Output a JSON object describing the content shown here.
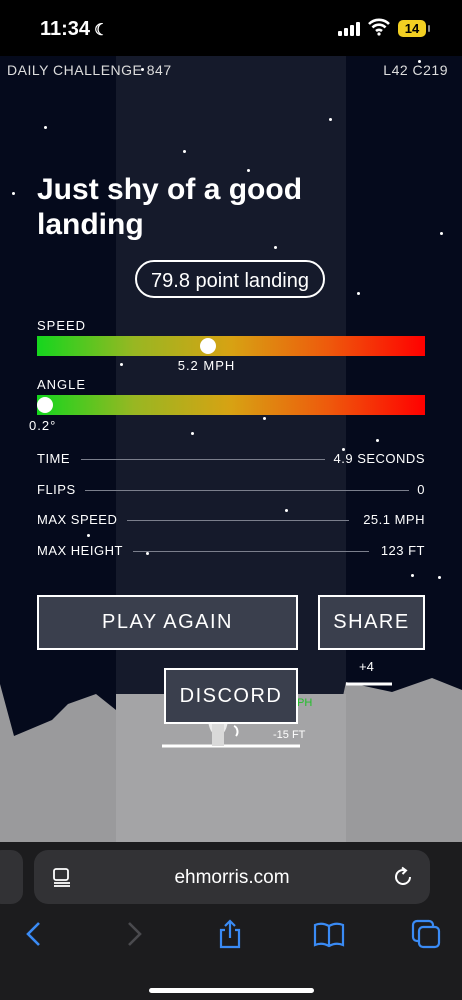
{
  "status": {
    "time": "11:34",
    "battery": "14"
  },
  "hud": {
    "challenge": "DAILY CHALLENGE 847",
    "level": "L42 C219"
  },
  "result": {
    "headline": "Just shy of a good landing",
    "points": "79.8 point landing"
  },
  "meters": {
    "speed": {
      "label": "SPEED",
      "value": "5.2 MPH",
      "level": 0.44
    },
    "angle": {
      "label": "ANGLE",
      "value": "0.2°",
      "level": 0.02
    }
  },
  "stats": [
    {
      "label": "TIME",
      "value": "4.9 SECONDS"
    },
    {
      "label": "FLIPS",
      "value": "0"
    },
    {
      "label": "MAX SPEED",
      "value": "25.1 MPH"
    },
    {
      "label": "MAX HEIGHT",
      "value": "123 FT"
    }
  ],
  "buttons": {
    "play_again": "PLAY AGAIN",
    "share": "SHARE",
    "discord": "DISCORD"
  },
  "scene": {
    "bonus": "+4",
    "altitude": "-15 FT",
    "speed_hint": "PH"
  },
  "browser": {
    "url": "ehmorris.com"
  },
  "colors": {
    "meter_start": "#15d61e",
    "meter_end": "#ff0000",
    "battery": "#f2cf22"
  }
}
